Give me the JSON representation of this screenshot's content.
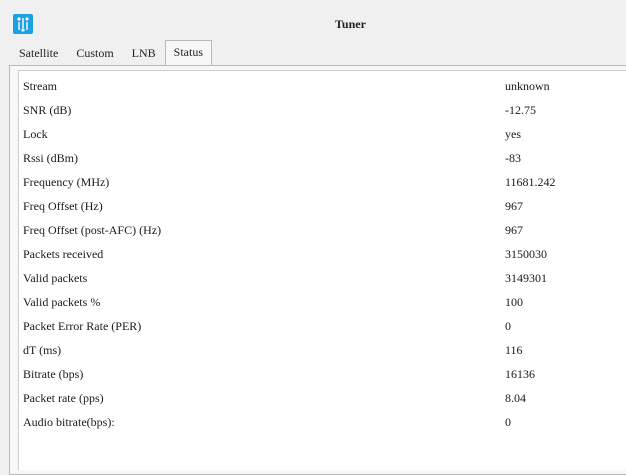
{
  "window": {
    "title": "Tuner",
    "icon": "app-icon"
  },
  "tabs": [
    {
      "label": "Satellite",
      "active": false
    },
    {
      "label": "Custom",
      "active": false
    },
    {
      "label": "LNB",
      "active": false
    },
    {
      "label": "Status",
      "active": true
    }
  ],
  "status": {
    "rows": [
      {
        "label": "Stream",
        "value": "unknown"
      },
      {
        "label": "SNR (dB)",
        "value": "-12.75"
      },
      {
        "label": "Lock",
        "value": "yes"
      },
      {
        "label": "Rssi (dBm)",
        "value": "-83"
      },
      {
        "label": "Frequency (MHz)",
        "value": "11681.242"
      },
      {
        "label": "Freq Offset (Hz)",
        "value": "967"
      },
      {
        "label": "Freq Offset (post-AFC) (Hz)",
        "value": "967"
      },
      {
        "label": "Packets received",
        "value": "3150030"
      },
      {
        "label": "Valid packets",
        "value": "3149301"
      },
      {
        "label": "Valid packets %",
        "value": "100"
      },
      {
        "label": "Packet Error Rate (PER)",
        "value": "0"
      },
      {
        "label": "dT (ms)",
        "value": "116"
      },
      {
        "label": "Bitrate (bps)",
        "value": "16136"
      },
      {
        "label": "Packet rate (pps)",
        "value": "8.04"
      },
      {
        "label": "Audio bitrate(bps):",
        "value": "0"
      }
    ]
  },
  "colors": {
    "accent": "#1ba1e2"
  }
}
